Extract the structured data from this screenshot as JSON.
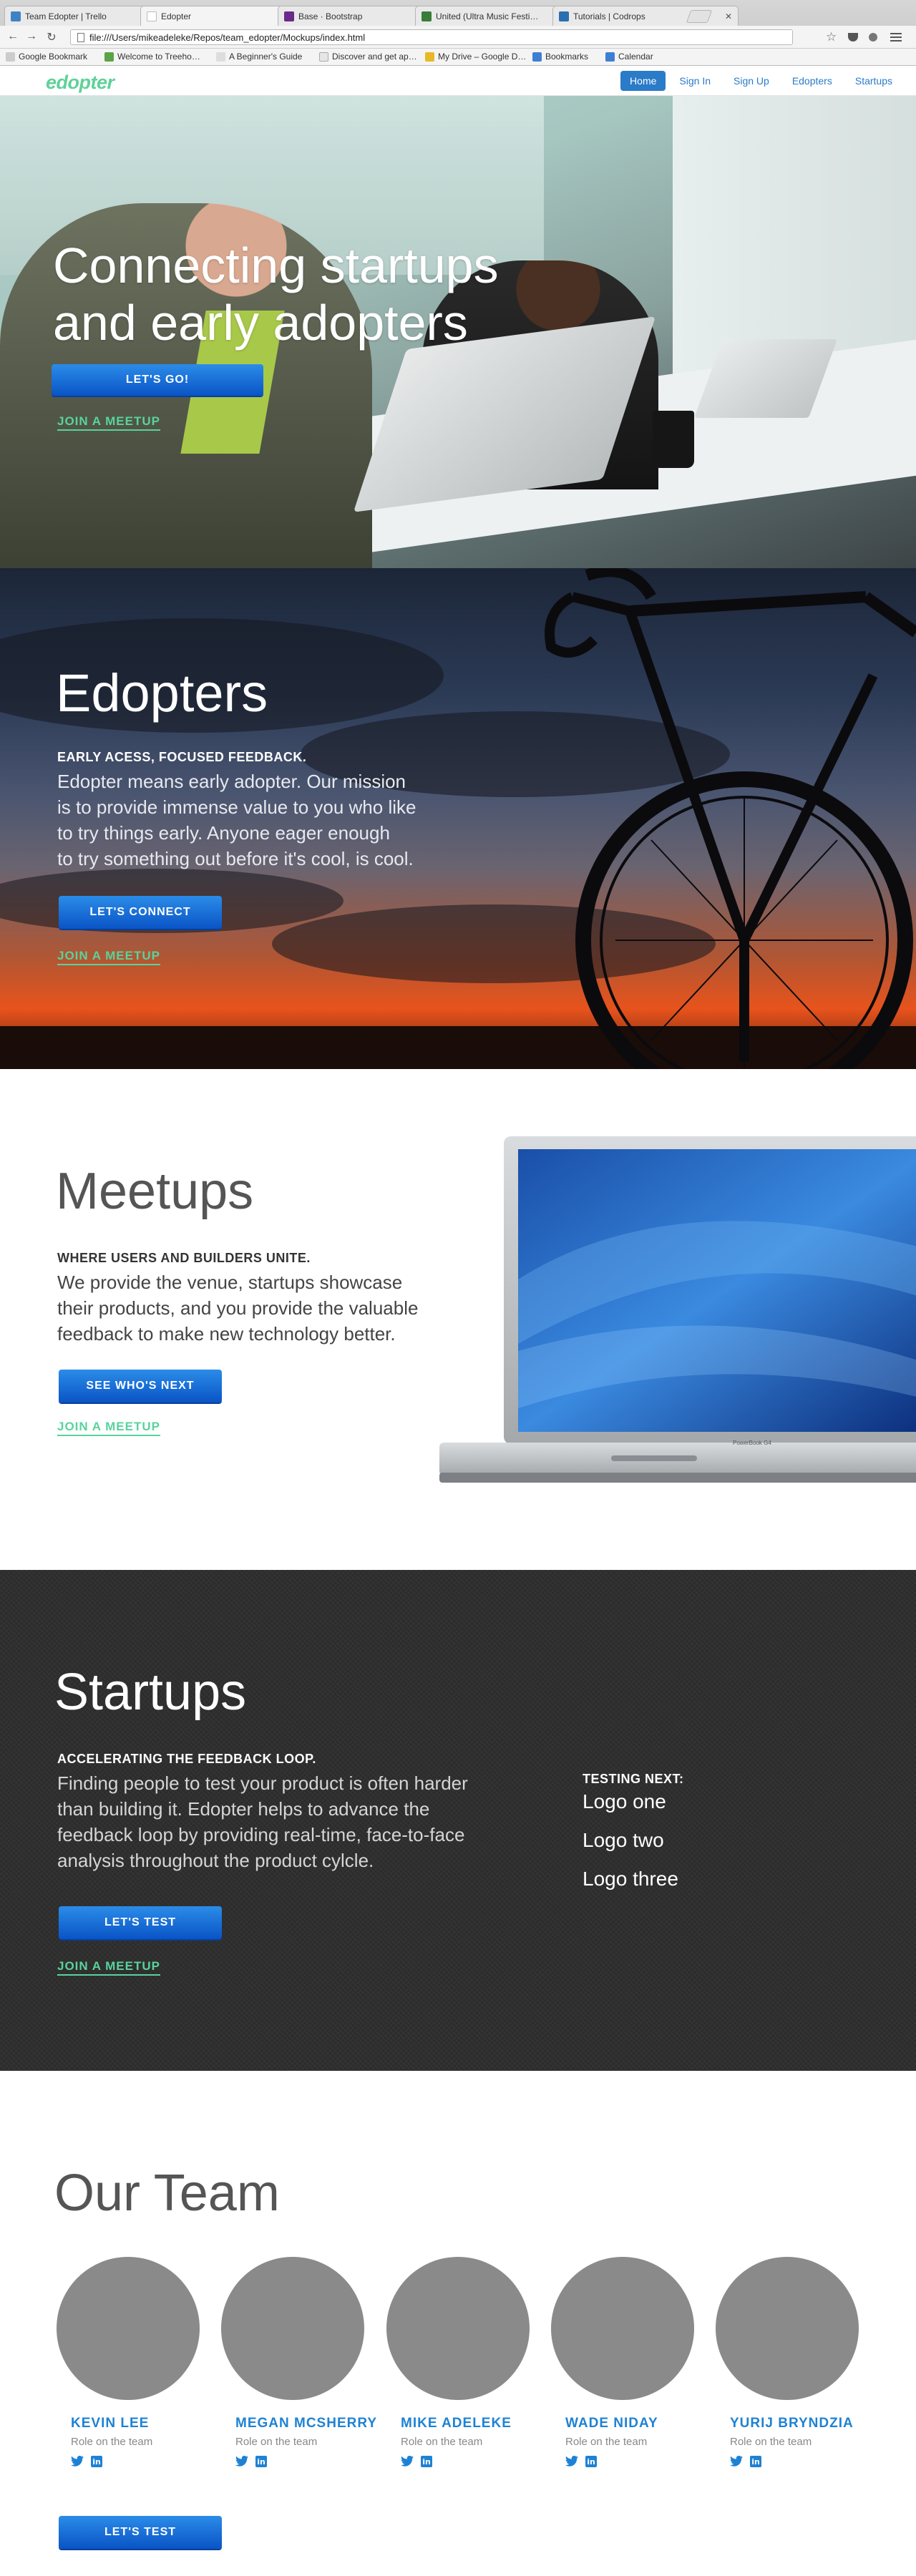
{
  "browser": {
    "tabs": [
      {
        "label": "Team Edopter | Trello",
        "color": "#3f82c3"
      },
      {
        "label": "Edopter",
        "color": "#ffffff"
      },
      {
        "label": "Base · Bootstrap",
        "color": "#6b2a8a"
      },
      {
        "label": "United (Ultra Music Festi…",
        "color": "#3a7d3a"
      },
      {
        "label": "Tutorials | Codrops",
        "color": "#2a6fb0"
      }
    ],
    "url": "file:///Users/mikeadeleke/Repos/team_edopter/Mockups/index.html",
    "bookmarks": [
      {
        "label": "Google Bookmark",
        "color": "#cccccc"
      },
      {
        "label": "Welcome to Treeho…",
        "color": "#5aa347"
      },
      {
        "label": "A Beginner's Guide",
        "color": "#dddddd"
      },
      {
        "label": "Discover and get ap…",
        "color": "#e6e6e6"
      },
      {
        "label": "My Drive – Google D…",
        "color": "#e6b927"
      },
      {
        "label": "Bookmarks",
        "color": "#3f7fd3"
      },
      {
        "label": "Calendar",
        "color": "#3f7fd3"
      }
    ]
  },
  "nav": {
    "brand": "edopter",
    "links": [
      "Home",
      "Sign In",
      "Sign Up",
      "Edopters",
      "Startups"
    ]
  },
  "hero": {
    "title_line1": "Connecting startups",
    "title_line2": "and early adopters",
    "cta": "LET'S GO!",
    "join": "JOIN A MEETUP"
  },
  "edopters": {
    "title": "Edopters",
    "kicker": "EARLY ACESS, FOCUSED FEEDBACK.",
    "body_lines": [
      "Edopter means early adopter. Our mission",
      "is to provide immense value to you who like",
      "to try things early. Anyone eager enough",
      "to try something out before it's cool, is cool."
    ],
    "cta": "LET'S CONNECT",
    "join": "JOIN A MEETUP"
  },
  "meetups": {
    "title": "Meetups",
    "kicker": "WHERE USERS AND BUILDERS UNITE.",
    "body_lines": [
      "We provide the venue, startups showcase",
      "their products, and you provide the valuable",
      "feedback to make new technology better."
    ],
    "cta": "SEE WHO'S NEXT",
    "join": "JOIN A MEETUP",
    "laptop_label": "PowerBook G4"
  },
  "startups": {
    "title": "Startups",
    "kicker": "ACCELERATING THE FEEDBACK LOOP.",
    "body_lines": [
      "Finding people to test your product is often harder",
      "than building it. Edopter helps to advance the",
      "feedback loop by providing real-time, face-to-face",
      "analysis throughout the product cylcle."
    ],
    "cta": "LET'S TEST",
    "join": "JOIN A MEETUP",
    "testing_next": {
      "heading": "TESTING NEXT:",
      "items": [
        "Logo one",
        "Logo two",
        "Logo three"
      ]
    }
  },
  "team": {
    "title": "Our Team",
    "members": [
      {
        "name": "KEVIN LEE",
        "role": "Role on the team"
      },
      {
        "name": "MEGAN MCSHERRY",
        "role": "Role on the team"
      },
      {
        "name": "MIKE ADELEKE",
        "role": "Role on the team"
      },
      {
        "name": "WADE NIDAY",
        "role": "Role on the team"
      },
      {
        "name": "YURIJ BRYNDZIA",
        "role": "Role on the team"
      }
    ],
    "cta": "LET'S TEST"
  },
  "colors": {
    "brand": "#5fd19a",
    "button": "#0a54c6",
    "link": "#2a7bc8"
  }
}
